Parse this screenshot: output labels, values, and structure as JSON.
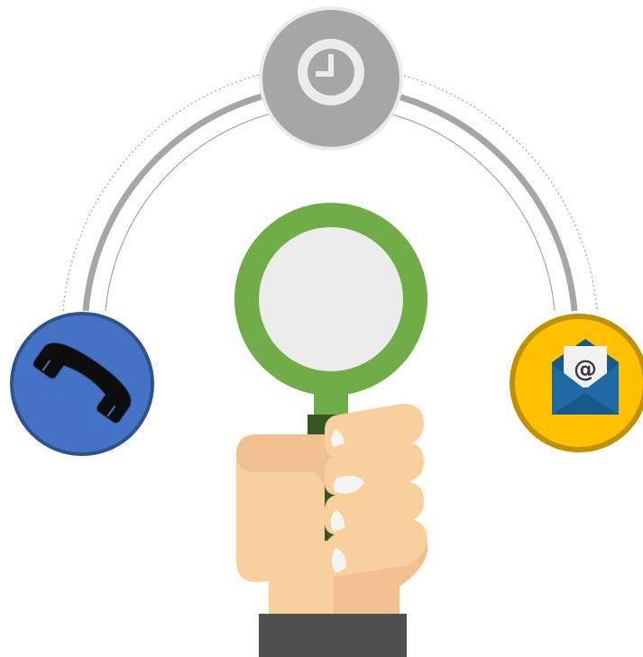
{
  "illustration": {
    "icons": {
      "top": "clock-icon",
      "left": "phone-icon",
      "right": "email-icon",
      "center": "magnifying-glass-icon",
      "hand": "hand-icon"
    },
    "email_symbol": "@",
    "colors": {
      "clock_circle": "#a6a6a6",
      "clock_ring": "#ebebeb",
      "phone_circle": "#4472c4",
      "phone_border": "#2f528f",
      "email_circle": "#ffc000",
      "email_border": "#bf9000",
      "envelope": "#1f6aa5",
      "envelope_dark": "#155a8a",
      "magnifier_ring": "#70ad47",
      "magnifier_lens": "#ececec",
      "magnifier_handle": "#375623",
      "skin": "#f9cf9c",
      "skin_shadow": "#f0c08f",
      "sleeve": "#4f4f4f",
      "arc": "#a6a6a6"
    }
  }
}
